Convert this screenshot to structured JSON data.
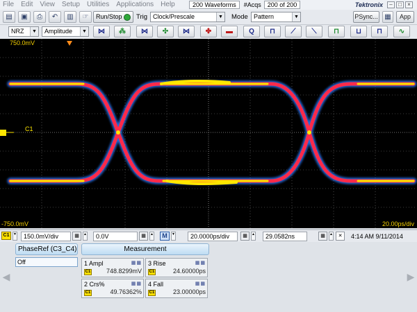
{
  "menu": {
    "items": [
      "File",
      "Edit",
      "View",
      "Setup",
      "Utilities",
      "Applications",
      "Help"
    ],
    "waveform_count": "200 Waveforms",
    "acqs_label": "#Acqs",
    "acqs_value": "200 of 200",
    "brand": "Tektronix"
  },
  "toolbar": {
    "run_stop": "Run/Stop",
    "trig_label": "Trig",
    "trig_value": "Clock/Prescale",
    "mode_label": "Mode",
    "mode_value": "Pattern",
    "psync": "PSync...",
    "app": "App"
  },
  "toolbar2": {
    "coding": "NRZ",
    "measure_type": "Amplitude"
  },
  "display": {
    "top_label": "750.0mV",
    "bottom_label": "-750.0mV",
    "timebase_label": "20.00ps/div",
    "channel_label": "C1",
    "trace_colors": {
      "outer": "#2e7bff",
      "mid": "#ff2a2a",
      "core": "#ffe600",
      "graticule": "#8c8c8c"
    }
  },
  "controls": {
    "channel": "C1",
    "vertical_scale": "150.0mV/div",
    "offset": "0.0V",
    "mode_button": "M",
    "horizontal_scale": "20.0000ps/div",
    "position": "29.0582ns",
    "datetime": "4:14 AM 9/11/2014"
  },
  "measurement": {
    "phase_ref_header": "PhaseRef (C3_C4)",
    "phase_ref_value": "Off",
    "header": "Measurement",
    "cells": [
      {
        "name": "1 Ampl",
        "value": "748.8299mV",
        "source": "C1"
      },
      {
        "name": "3 Rise",
        "value": "24.60000ps",
        "source": "C1"
      },
      {
        "name": "2 Crs%",
        "value": "49.76362%",
        "source": "C1"
      },
      {
        "name": "4 Fall",
        "value": "23.00000ps",
        "source": "C1"
      }
    ]
  }
}
